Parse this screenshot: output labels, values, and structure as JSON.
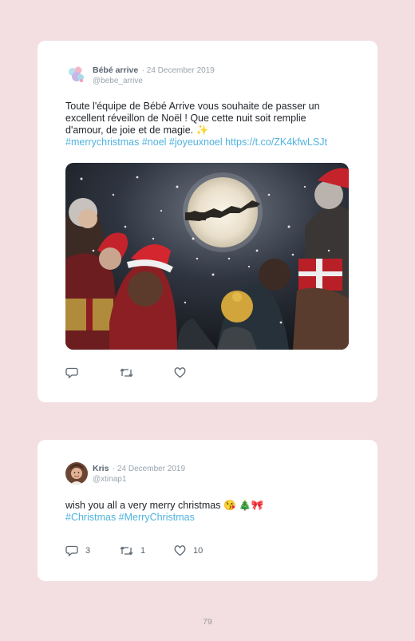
{
  "tweets": [
    {
      "author": "Bébé arrive",
      "date": "· 24 December 2019",
      "handle": "@bebe_arrive",
      "text": "Toute l'équipe de Bébé Arrive vous souhaite de passer un excellent réveillon de Noël ! Que cette nuit soit remplie d'amour, de joie et de magie. ✨",
      "hashtags": "#merrychristmas #noel #joyeuxnoel https://t.co/ZK4kfwLSJt",
      "replies": "",
      "retweets": "",
      "likes": ""
    },
    {
      "author": "Kris",
      "date": "· 24 December 2019",
      "handle": "@xtinap1",
      "text": "wish you all a very merry christmas 😘 🎄🎀",
      "hashtags": "#Christmas #MerryChristmas",
      "replies": "3",
      "retweets": "1",
      "likes": "10"
    }
  ],
  "page_number": "79",
  "colors": {
    "background": "#f3dfe1",
    "card": "#ffffff",
    "link": "#4fb3df"
  },
  "icons": [
    "reply-icon",
    "retweet-icon",
    "like-icon"
  ]
}
